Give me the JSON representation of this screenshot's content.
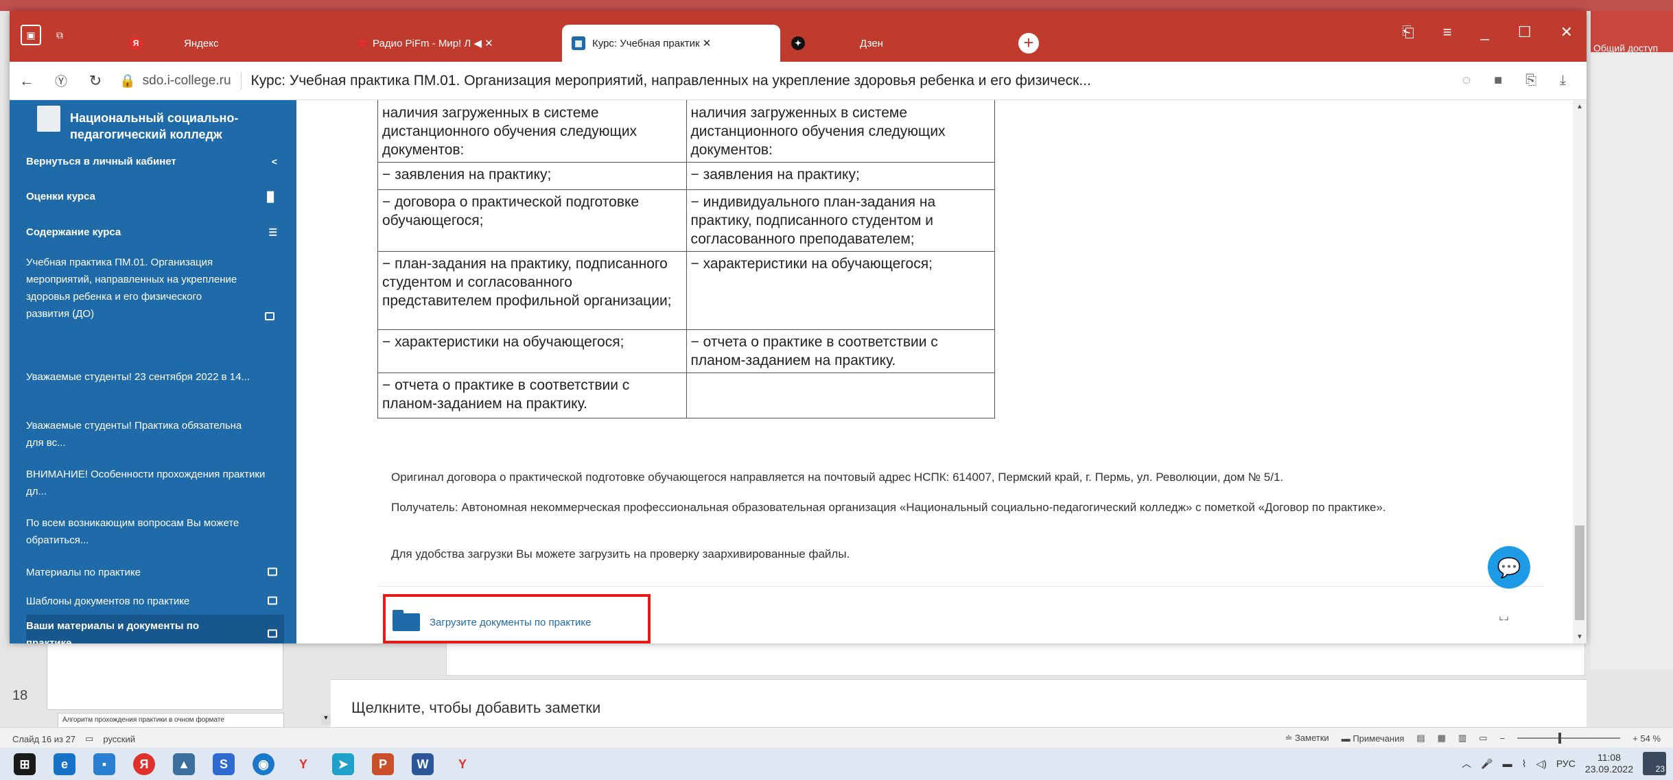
{
  "browser": {
    "tabs": [
      {
        "label": "Яндекс",
        "icon": "yandex-icon"
      },
      {
        "label": "Радио PiFm - Мир! Л ◀ ✕",
        "icon": "radio-icon"
      },
      {
        "label": "Курс: Учебная практик ✕",
        "icon": "course-icon"
      },
      {
        "label": "Дзен",
        "icon": "zen-icon"
      }
    ],
    "address": {
      "host": "sdo.i-college.ru",
      "title": "Курс: Учебная практика ПМ.01. Организация мероприятий, направленных на укрепление здоровья ребенка и его физическ..."
    }
  },
  "sidebar": {
    "org_line1": "Национальный социально-",
    "org_line2": "педагогический колледж",
    "items": [
      {
        "label": "Вернуться в личный кабинет",
        "icon": "<"
      },
      {
        "label": "Оценки курса",
        "icon": "chart-icon"
      },
      {
        "label": "Содержание курса",
        "icon": "list-icon"
      },
      {
        "label": "Учебная практика ПМ.01. Организация мероприятий, направленных на укрепление здоровья ребенка и его физического развития (ДО)"
      },
      {
        "label": "Уважаемые студенты! 23 сентября 2022 в 14..."
      },
      {
        "label": "Уважаемые студенты! Практика обязательна для вс..."
      },
      {
        "label": "ВНИМАНИЕ! Особенности прохождения практики дл..."
      },
      {
        "label": "По всем возникающим вопросам Вы можете обратиться..."
      },
      {
        "label": "Материалы по практике"
      },
      {
        "label": "Шаблоны документов по практике"
      },
      {
        "label": "Ваши материалы и документы по практике"
      }
    ]
  },
  "table": {
    "rows": [
      [
        "наличия загруженных в системе дистанционного обучения следующих документов:",
        "наличия загруженных в системе дистанционного обучения следующих документов:"
      ],
      [
        "− заявления на практику;",
        "− заявления на практику;"
      ],
      [
        "− договора о практической подготовке обучающегося;",
        "− индивидуального план-задания на практику, подписанного студентом и согласованного преподавателем;"
      ],
      [
        "− план-задания на практику, подписанного студентом и согласованного представителем профильной организации;",
        "− характеристики на обучающегося;"
      ],
      [
        "− характеристики на обучающегося;",
        "− отчета о практике в соответствии с планом-заданием на практику."
      ],
      [
        "− отчета о практике в соответствии с планом-заданием на практику.",
        ""
      ]
    ]
  },
  "paragraphs": {
    "p1": "Оригинал договора о практической подготовке обучающегося направляется на почтовый адрес НСПК: 614007, Пермский край, г. Пермь, ул. Революции, дом № 5/1.",
    "p2": "Получатель: Автономная некоммерческая профессиональная образовательная организация «Национальный социально-педагогический колледж» с пометкой «Договор по практике».",
    "p3": "Для удобства загрузки Вы можете загрузить на проверку заархивированные файлы."
  },
  "upload": {
    "label": "Загрузите документы по практике"
  },
  "ppt": {
    "right_top_label": "Общий доступ",
    "slide_number": "18",
    "thumb_text": "Алгоритм прохождения практики в очном формате",
    "notes_placeholder": "Щелкните, чтобы добавить заметки",
    "status_slide": "Слайд 16 из 27",
    "status_lang": "русский",
    "status_notes": "≐ Заметки",
    "status_comments": "Примечания",
    "zoom": "+ 54 %"
  },
  "taskbar": {
    "lang": "РУС",
    "time": "11:08",
    "date": "23.09.2022",
    "notif_count": "23"
  },
  "colors": {
    "accent": "#1f6aa8",
    "browser_red": "#c03a2e",
    "highlight": "#e31b1b"
  }
}
